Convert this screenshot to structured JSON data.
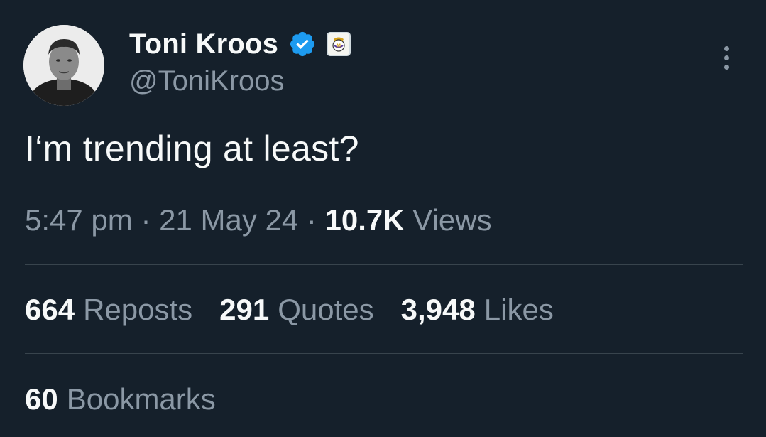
{
  "author": {
    "display_name": "Toni Kroos",
    "handle": "@ToniKroos",
    "verified_icon": "verified-badge-icon",
    "affiliate_badge_icon": "real-madrid-crest-icon",
    "accent_color": "#1d9bf0"
  },
  "tweet": {
    "text": "I‘m trending at least?",
    "time": "5:47 pm",
    "separator": "·",
    "date": "21 May 24",
    "views_count": "10.7K",
    "views_label": "Views"
  },
  "stats": {
    "reposts_count": "664",
    "reposts_label": "Reposts",
    "quotes_count": "291",
    "quotes_label": "Quotes",
    "likes_count": "3,948",
    "likes_label": "Likes",
    "bookmarks_count": "60",
    "bookmarks_label": "Bookmarks"
  },
  "menu": {
    "more_icon": "more-vertical-icon"
  },
  "colors": {
    "background": "#15202b",
    "primary_text": "#f7f9f9",
    "secondary_text": "#8b98a5",
    "divider": "#38444d"
  }
}
